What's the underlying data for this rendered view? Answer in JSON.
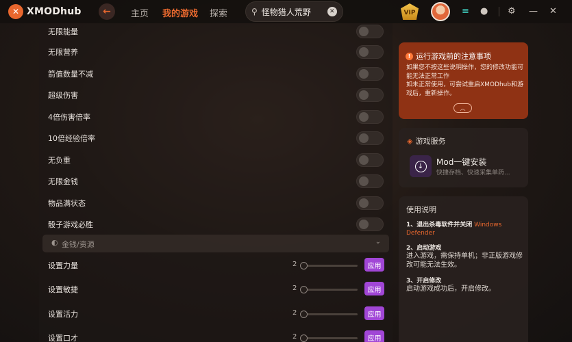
{
  "header": {
    "logo_text": "XMODhub",
    "nav": [
      "主页",
      "我的游戏",
      "探索"
    ],
    "active_nav": "我的游戏",
    "search_value": "怪物猎人荒野",
    "vip_label": "VIP"
  },
  "toggles": [
    {
      "label": "无限能量",
      "on": false
    },
    {
      "label": "无限营养",
      "on": false
    },
    {
      "label": "箭值数量不减",
      "on": false
    },
    {
      "label": "超级伤害",
      "on": false
    },
    {
      "label": "4倍伤害倍率",
      "on": false
    },
    {
      "label": "10倍经验倍率",
      "on": false
    },
    {
      "label": "无负重",
      "on": false
    },
    {
      "label": "无限金钱",
      "on": false
    },
    {
      "label": "物品满状态",
      "on": false
    },
    {
      "label": "骰子游戏必胜",
      "on": false
    }
  ],
  "section": {
    "label": "金钱/资源"
  },
  "sliders": [
    {
      "label": "设置力量",
      "value": "2",
      "apply_label": "应用"
    },
    {
      "label": "设置敏捷",
      "value": "2",
      "apply_label": "应用"
    },
    {
      "label": "设置活力",
      "value": "2",
      "apply_label": "应用"
    },
    {
      "label": "设置口才",
      "value": "2",
      "apply_label": "应用"
    }
  ],
  "notice": {
    "title": "运行游戏前的注意事项",
    "body_line1": "如果您不按这些说明操作，您的修改功能可能无法正常工作",
    "body_line2": "如未正常使用，可尝试重启XMODhub和游戏后，重新操作。",
    "collapse_icon": "chevron-up-icon"
  },
  "service": {
    "title": "游戏服务",
    "name": "Mod一键安装",
    "desc": "快捷存档、快速采集单药..."
  },
  "usage": {
    "title": "使用说明",
    "step1_head": "1、退出杀毒软件并关闭",
    "step1_highlight": "Windows Defender",
    "step2_head": "2、启动游戏",
    "step2_text": "进入游戏，需保持单机；非正版游戏修改可能无法生效。",
    "step3_head": "3、开启修改",
    "step3_text": "启动游戏成功后，开启修改。"
  },
  "colors": {
    "accent": "#ec6a2f",
    "apply_purple": "#a146d6",
    "notice_bg": "#8f3214"
  }
}
